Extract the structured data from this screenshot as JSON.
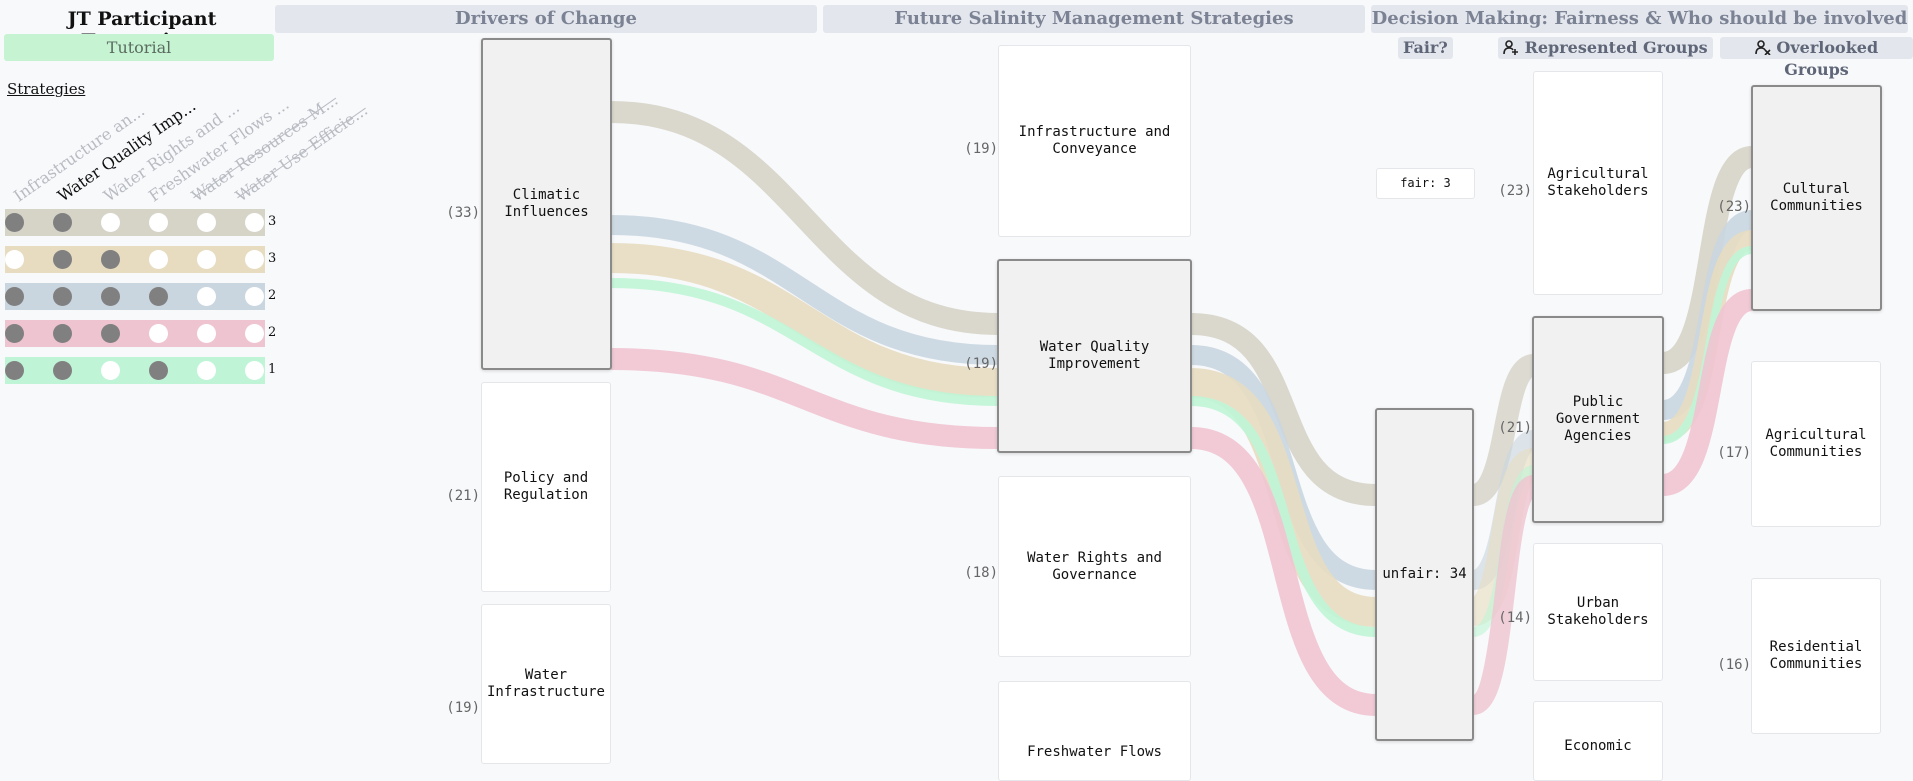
{
  "app": {
    "title": "JT Participant Transcripts",
    "tutorial_label": "Tutorial",
    "strategies_label": "Strategies"
  },
  "strategies": [
    {
      "label": "Infrastructure an...",
      "state": "inactive"
    },
    {
      "label": "Water Quality Imp...",
      "state": "active"
    },
    {
      "label": "Water Rights and ...",
      "state": "inactive"
    },
    {
      "label": "Freshwater Flows ...",
      "state": "inactive"
    },
    {
      "label": "Water Resources M...",
      "state": "struck"
    },
    {
      "label": "Water Use Efficie...",
      "state": "struck"
    }
  ],
  "pattern_rows": [
    {
      "color": "#d6d3c7",
      "dots": [
        1,
        1,
        0,
        0,
        0,
        0
      ],
      "count": "3"
    },
    {
      "color": "#e7dcc0",
      "dots": [
        0,
        1,
        1,
        0,
        0,
        0
      ],
      "count": "3"
    },
    {
      "color": "#c9d6e0",
      "dots": [
        1,
        1,
        1,
        1,
        0,
        0
      ],
      "count": "2"
    },
    {
      "color": "#efc4d1",
      "dots": [
        1,
        1,
        1,
        0,
        0,
        0
      ],
      "count": "2"
    },
    {
      "color": "#bff5d6",
      "dots": [
        1,
        1,
        0,
        1,
        0,
        0
      ],
      "count": "1"
    }
  ],
  "headers": {
    "drivers": "Drivers of Change",
    "strategies": "Future Salinity Management Strategies",
    "decision": "Decision Making: Fairness & Who should be involved",
    "fair": "Fair?",
    "represented": "Represented Groups",
    "overlooked": "Overlooked Groups"
  },
  "drivers": [
    {
      "label": "Climatic Influences",
      "count": "(33)"
    },
    {
      "label": "Policy and Regulation",
      "count": "(21)"
    },
    {
      "label": "Water Infrastructure",
      "count": "(19)"
    }
  ],
  "strategy_nodes": [
    {
      "label": "Infrastructure and Conveyance",
      "count": "(19)"
    },
    {
      "label": "Water Quality Improvement",
      "count": "(19)"
    },
    {
      "label": "Water Rights and Governance",
      "count": "(18)"
    },
    {
      "label": "Freshwater Flows",
      "count": ""
    }
  ],
  "fairness": {
    "fair_label": "fair: 3",
    "unfair_label": "unfair: 34"
  },
  "represented": [
    {
      "label": "Agricultural Stakeholders",
      "count": "(23)"
    },
    {
      "label": "Public Government Agencies",
      "count": "(21)"
    },
    {
      "label": "Urban Stakeholders",
      "count": "(14)"
    },
    {
      "label": "Economic",
      "count": ""
    }
  ],
  "overlooked": [
    {
      "label": "Cultural Communities",
      "count": "(23)"
    },
    {
      "label": "Agricultural Communities",
      "count": "(17)"
    },
    {
      "label": "Residential Communities",
      "count": "(16)"
    }
  ],
  "colors": {
    "dot_on": "#808080",
    "dot_off": "#ffffff"
  }
}
